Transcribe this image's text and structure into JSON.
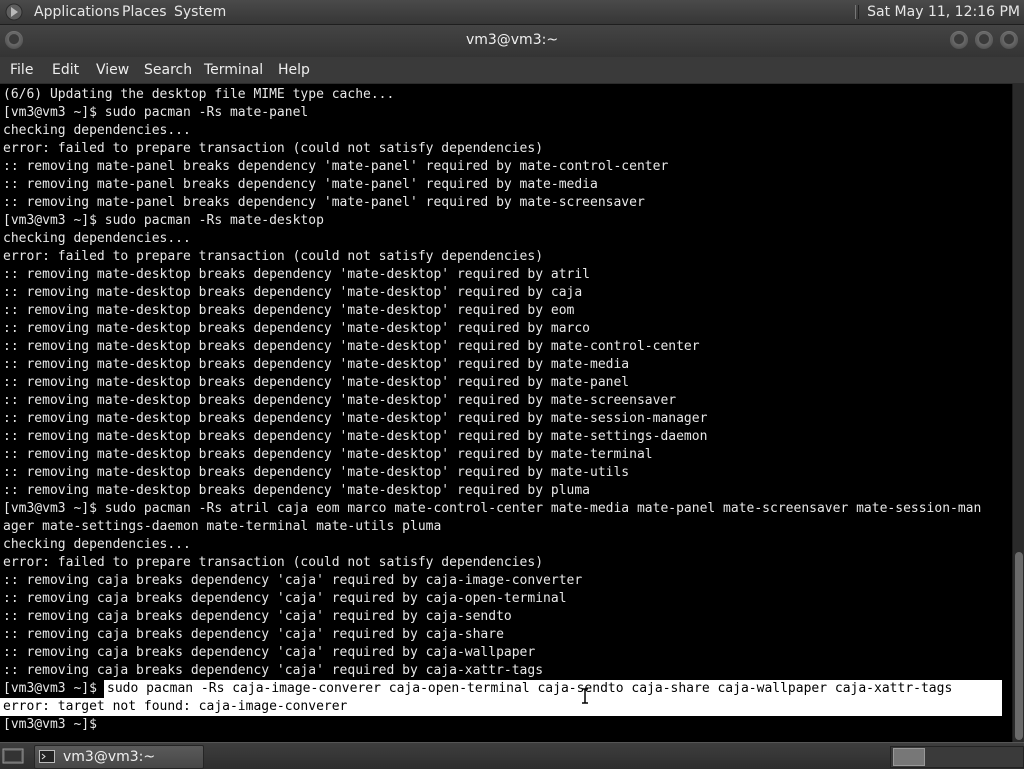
{
  "top_panel": {
    "menus": [
      "Applications",
      "Places",
      "System"
    ],
    "clock": "Sat May 11, 12:16 PM",
    "logo_icon": "mate-logo-icon"
  },
  "window": {
    "title": "vm3@vm3:~",
    "buttons": [
      "minimize",
      "maximize",
      "close"
    ]
  },
  "menubar": {
    "items": [
      "File",
      "Edit",
      "View",
      "Search",
      "Terminal",
      "Help"
    ]
  },
  "terminal": {
    "lines": [
      "(6/6) Updating the desktop file MIME type cache...",
      "[vm3@vm3 ~]$ sudo pacman -Rs mate-panel",
      "checking dependencies...",
      "error: failed to prepare transaction (could not satisfy dependencies)",
      ":: removing mate-panel breaks dependency 'mate-panel' required by mate-control-center",
      ":: removing mate-panel breaks dependency 'mate-panel' required by mate-media",
      ":: removing mate-panel breaks dependency 'mate-panel' required by mate-screensaver",
      "[vm3@vm3 ~]$ sudo pacman -Rs mate-desktop",
      "checking dependencies...",
      "error: failed to prepare transaction (could not satisfy dependencies)",
      ":: removing mate-desktop breaks dependency 'mate-desktop' required by atril",
      ":: removing mate-desktop breaks dependency 'mate-desktop' required by caja",
      ":: removing mate-desktop breaks dependency 'mate-desktop' required by eom",
      ":: removing mate-desktop breaks dependency 'mate-desktop' required by marco",
      ":: removing mate-desktop breaks dependency 'mate-desktop' required by mate-control-center",
      ":: removing mate-desktop breaks dependency 'mate-desktop' required by mate-media",
      ":: removing mate-desktop breaks dependency 'mate-desktop' required by mate-panel",
      ":: removing mate-desktop breaks dependency 'mate-desktop' required by mate-screensaver",
      ":: removing mate-desktop breaks dependency 'mate-desktop' required by mate-session-manager",
      ":: removing mate-desktop breaks dependency 'mate-desktop' required by mate-settings-daemon",
      ":: removing mate-desktop breaks dependency 'mate-desktop' required by mate-terminal",
      ":: removing mate-desktop breaks dependency 'mate-desktop' required by mate-utils",
      ":: removing mate-desktop breaks dependency 'mate-desktop' required by pluma",
      "[vm3@vm3 ~]$ sudo pacman -Rs atril caja eom marco mate-control-center mate-media mate-panel mate-screensaver mate-session-man",
      "ager mate-settings-daemon mate-terminal mate-utils pluma",
      "checking dependencies...",
      "error: failed to prepare transaction (could not satisfy dependencies)",
      ":: removing caja breaks dependency 'caja' required by caja-image-converter",
      ":: removing caja breaks dependency 'caja' required by caja-open-terminal",
      ":: removing caja breaks dependency 'caja' required by caja-sendto",
      ":: removing caja breaks dependency 'caja' required by caja-share",
      ":: removing caja breaks dependency 'caja' required by caja-wallpaper",
      ":: removing caja breaks dependency 'caja' required by caja-xattr-tags"
    ],
    "selected_prompt": "[vm3@vm3 ~]$ ",
    "selected_command": "sudo pacman -Rs caja-image-converer caja-open-terminal caja-sendto caja-share caja-wallpaper caja-xattr-tags",
    "selected_error": "error: target not found: caja-image-converer",
    "final_prompt": "[vm3@vm3 ~]$"
  },
  "taskbar": {
    "window_label": "vm3@vm3:~",
    "window_icon": "terminal-icon",
    "show_desktop_icon": "show-desktop-icon"
  }
}
